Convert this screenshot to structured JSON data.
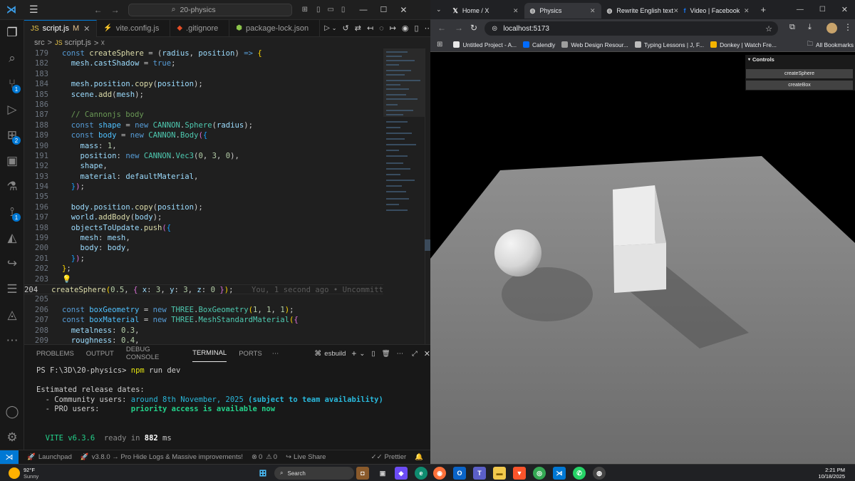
{
  "vscode": {
    "search": "20-physics",
    "tabs": [
      {
        "label": "script.js",
        "suffix": "M",
        "icon": "JS",
        "color": "#e8c54a",
        "active": true
      },
      {
        "label": "vite.config.js",
        "suffix": "",
        "icon": "⚡",
        "color": "#bd93f9",
        "active": false
      },
      {
        "label": ".gitignore",
        "suffix": "",
        "icon": "◆",
        "color": "#e44d26",
        "active": false
      },
      {
        "label": "package-lock.json",
        "suffix": "",
        "icon": "⬢",
        "color": "#8bc34a",
        "active": false
      }
    ],
    "breadcrumb": {
      "folder": "src",
      "sep": ">",
      "file": "script.js",
      "more": "> ☓"
    },
    "badges": {
      "scm": "1",
      "extensions": "2",
      "remote": "1"
    },
    "code": [
      {
        "n": "179",
        "html": "<span style='color:#569cd6'>const</span> <span style='color:#dcdcaa'>createSphere</span> <span style='color:#ccc'>= (</span><span style='color:#9cdcfe'>radius</span><span style='color:#ccc'>, </span><span style='color:#9cdcfe'>position</span><span style='color:#ccc'>) </span><span style='color:#569cd6'>=></span> <span style='color:#ffd700'>{</span>"
      },
      {
        "n": "182",
        "html": "  mesh.castShadow <span style='color:#ccc'>=</span> <span style='color:#569cd6'>true</span><span style='color:#ccc'>;</span>"
      },
      {
        "n": "183",
        "html": ""
      },
      {
        "n": "184",
        "html": "  mesh.position.<span style='color:#dcdcaa'>copy</span><span style='color:#ccc'>(</span>position<span style='color:#ccc'>);</span>"
      },
      {
        "n": "185",
        "html": "  scene.<span style='color:#dcdcaa'>add</span><span style='color:#ccc'>(</span>mesh<span style='color:#ccc'>);</span>"
      },
      {
        "n": "186",
        "html": ""
      },
      {
        "n": "187",
        "html": "  <span style='color:#6a9955'>// Cannonjs body</span>"
      },
      {
        "n": "188",
        "html": "  <span style='color:#569cd6'>const</span> <span style='color:#4fc1ff'>shape</span> <span style='color:#ccc'>=</span> <span style='color:#569cd6'>new</span> <span style='color:#4ec9b0'>CANNON</span><span style='color:#ccc'>.</span><span style='color:#4ec9b0'>Sphere</span><span style='color:#ccc'>(</span>radius<span style='color:#ccc'>);</span>"
      },
      {
        "n": "189",
        "html": "  <span style='color:#569cd6'>const</span> <span style='color:#4fc1ff'>body</span> <span style='color:#ccc'>=</span> <span style='color:#569cd6'>new</span> <span style='color:#4ec9b0'>CANNON</span><span style='color:#ccc'>.</span><span style='color:#4ec9b0'>Body</span><span style='color:#da70d6'>(</span><span style='color:#179fff'>{</span>"
      },
      {
        "n": "190",
        "html": "    mass<span style='color:#ccc'>:</span> <span style='color:#b5cea8'>1</span><span style='color:#ccc'>,</span>"
      },
      {
        "n": "191",
        "html": "    position<span style='color:#ccc'>:</span> <span style='color:#569cd6'>new</span> <span style='color:#4ec9b0'>CANNON</span><span style='color:#ccc'>.</span><span style='color:#4ec9b0'>Vec3</span><span style='color:#ccc'>(</span><span style='color:#b5cea8'>0</span><span style='color:#ccc'>, </span><span style='color:#b5cea8'>3</span><span style='color:#ccc'>, </span><span style='color:#b5cea8'>0</span><span style='color:#ccc'>),</span>"
      },
      {
        "n": "192",
        "html": "    shape<span style='color:#ccc'>,</span>"
      },
      {
        "n": "193",
        "html": "    material<span style='color:#ccc'>:</span> defaultMaterial<span style='color:#ccc'>,</span>"
      },
      {
        "n": "194",
        "html": "  <span style='color:#179fff'>}</span><span style='color:#da70d6'>)</span><span style='color:#ccc'>;</span>"
      },
      {
        "n": "195",
        "html": ""
      },
      {
        "n": "196",
        "html": "  body.position.<span style='color:#dcdcaa'>copy</span><span style='color:#ccc'>(</span>position<span style='color:#ccc'>);</span>"
      },
      {
        "n": "197",
        "html": "  world.<span style='color:#dcdcaa'>addBody</span><span style='color:#ccc'>(</span>body<span style='color:#ccc'>);</span>"
      },
      {
        "n": "198",
        "html": "  objectsToUpdate.<span style='color:#dcdcaa'>push</span><span style='color:#da70d6'>(</span><span style='color:#179fff'>{</span>"
      },
      {
        "n": "199",
        "html": "    mesh<span style='color:#ccc'>:</span> mesh<span style='color:#ccc'>,</span>"
      },
      {
        "n": "200",
        "html": "    body<span style='color:#ccc'>:</span> body<span style='color:#ccc'>,</span>"
      },
      {
        "n": "201",
        "html": "  <span style='color:#179fff'>}</span><span style='color:#da70d6'>)</span><span style='color:#ccc'>;</span>"
      },
      {
        "n": "202",
        "html": "<span style='color:#ffd700'>}</span><span style='color:#ccc'>;</span>"
      },
      {
        "n": "203",
        "html": "<span style='color:#ffcc00'>💡</span>"
      },
      {
        "n": "204",
        "html": "<span style='color:#dcdcaa'>createSphere</span><span style='color:#ffd700'>(</span><span style='color:#b5cea8'>0.5</span><span style='color:#ccc'>, </span><span style='color:#da70d6'>{</span> x<span style='color:#ccc'>:</span> <span style='color:#b5cea8'>3</span><span style='color:#ccc'>,</span> y<span style='color:#ccc'>:</span> <span style='color:#b5cea8'>3</span><span style='color:#ccc'>,</span> z<span style='color:#ccc'>:</span> <span style='color:#b5cea8'>0</span> <span style='color:#da70d6'>}</span><span style='color:#ffd700'>)</span><span style='color:#ccc'>;</span>    <span style='color:#5a5a5a'>You, 1 second ago • Uncommitted</span>",
        "current": true
      },
      {
        "n": "205",
        "html": ""
      },
      {
        "n": "206",
        "html": "<span style='color:#569cd6'>const</span> <span style='color:#4fc1ff'>boxGeometry</span> <span style='color:#ccc'>=</span> <span style='color:#569cd6'>new</span> <span style='color:#4ec9b0'>THREE</span><span style='color:#ccc'>.</span><span style='color:#4ec9b0'>BoxGeometry</span><span style='color:#ffd700'>(</span><span style='color:#b5cea8'>1</span><span style='color:#ccc'>, </span><span style='color:#b5cea8'>1</span><span style='color:#ccc'>, </span><span style='color:#b5cea8'>1</span><span style='color:#ffd700'>)</span><span style='color:#ccc'>;</span>"
      },
      {
        "n": "207",
        "html": "<span style='color:#569cd6'>const</span> <span style='color:#4fc1ff'>boxMaterial</span> <span style='color:#ccc'>=</span> <span style='color:#569cd6'>new</span> <span style='color:#4ec9b0'>THREE</span><span style='color:#ccc'>.</span><span style='color:#4ec9b0'>MeshStandardMaterial</span><span style='color:#ffd700'>(</span><span style='color:#da70d6'>{</span>"
      },
      {
        "n": "208",
        "html": "  metalness<span style='color:#ccc'>:</span> <span style='color:#b5cea8'>0.3</span><span style='color:#ccc'>,</span>"
      },
      {
        "n": "209",
        "html": "  roughness<span style='color:#ccc'>:</span> <span style='color:#b5cea8'>0.4</span><span style='color:#ccc'>,</span>"
      }
    ],
    "panel_tabs": [
      "PROBLEMS",
      "OUTPUT",
      "DEBUG CONSOLE",
      "TERMINAL",
      "PORTS"
    ],
    "panel_active": "TERMINAL",
    "terminal_name": "esbuild",
    "terminal_html": "PS F:\\3D\\20-physics&gt; <span style='color:#e5e510'>npm</span> run dev\n\n<span>Estimated release dates:</span>\n  - Community users: <span style='color:#29b8db'>around 8th November, 2025</span> <span style='color:#29b8db;font-weight:bold'>(subject to team availability)</span>\n  - PRO users:       <span style='color:#23d18b;font-weight:bold'>priority access is available now</span>\n\n\n  <span style='color:#23d18b'>VITE v6.3.6</span>  <span style='color:#8a8a8a'>ready in</span> <b style='color:#fff'>882</b> ms",
    "status": {
      "launchpad": "Launchpad",
      "update": "v3.8.0 → Pro Hide Logs & Massive improvements!",
      "errors": "0",
      "warnings": "0",
      "liveshare": "Live Share",
      "prettier": "Prettier"
    }
  },
  "browser": {
    "tabs": [
      {
        "label": "Home / X",
        "icon": "𝕏",
        "color": "#fff",
        "active": false
      },
      {
        "label": "Physics",
        "icon": "◍",
        "color": "#ccc",
        "active": true
      },
      {
        "label": "Rewrite English text",
        "icon": "◍",
        "color": "#ccc",
        "active": false
      },
      {
        "label": "Video | Facebook",
        "icon": "f",
        "color": "#1877f2",
        "active": false
      }
    ],
    "url": "localhost:5173",
    "bookmarks": [
      {
        "label": "Untitled Project - A...",
        "color": "#e8e8e8"
      },
      {
        "label": "Calendly",
        "color": "#006bff"
      },
      {
        "label": "Web Design Resour...",
        "color": "#9e9e9e"
      },
      {
        "label": "Typing Lessons | J, F...",
        "color": "#bdbdbd"
      },
      {
        "label": "Donkey | Watch Fre...",
        "color": "#f4b400"
      }
    ],
    "all_bookmarks": "All Bookmarks",
    "gui": {
      "title": "Controls",
      "buttons": [
        "createSphere",
        "createBox"
      ]
    }
  },
  "taskbar": {
    "temp": "92°F",
    "weather": "Sunny",
    "search": "Search",
    "time": "2:21 PM",
    "date": "10/18/2025"
  }
}
